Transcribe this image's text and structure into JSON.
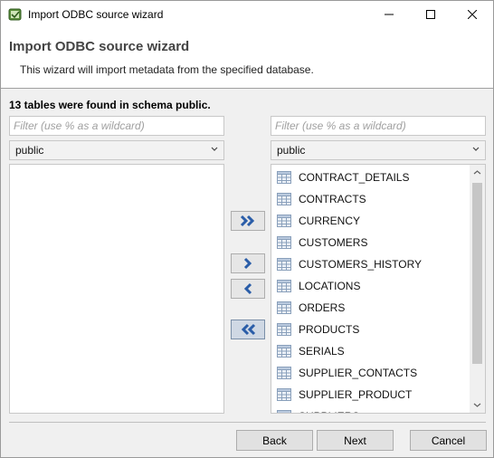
{
  "window": {
    "title": "Import ODBC source wizard",
    "icon": "wizard-app-icon"
  },
  "header": {
    "title": "Import ODBC source wizard",
    "description": "This wizard will import metadata from the specified database."
  },
  "status": {
    "found_text": "13 tables were found in schema public."
  },
  "left": {
    "filter_placeholder": "Filter (use % as a wildcard)",
    "schema": "public",
    "items": []
  },
  "right": {
    "filter_placeholder": "Filter (use % as a wildcard)",
    "schema": "public",
    "items": [
      {
        "label": "CONTRACT_DETAILS"
      },
      {
        "label": "CONTRACTS"
      },
      {
        "label": "CURRENCY"
      },
      {
        "label": "CUSTOMERS"
      },
      {
        "label": "CUSTOMERS_HISTORY"
      },
      {
        "label": "LOCATIONS"
      },
      {
        "label": "ORDERS"
      },
      {
        "label": "PRODUCTS"
      },
      {
        "label": "SERIALS"
      },
      {
        "label": "SUPPLIER_CONTACTS"
      },
      {
        "label": "SUPPLIER_PRODUCT"
      },
      {
        "label": "SUPPLIERS"
      }
    ]
  },
  "move_buttons": {
    "add_all_icon": "double-chevron-right-icon",
    "add_icon": "chevron-right-icon",
    "remove_icon": "chevron-left-icon",
    "remove_all_icon": "double-chevron-left-icon"
  },
  "footer": {
    "back_label": "Back",
    "next_label": "Next",
    "cancel_label": "Cancel"
  },
  "colors": {
    "arrow_blue": "#2a5da8",
    "selected_button": "#cfd8e4"
  }
}
